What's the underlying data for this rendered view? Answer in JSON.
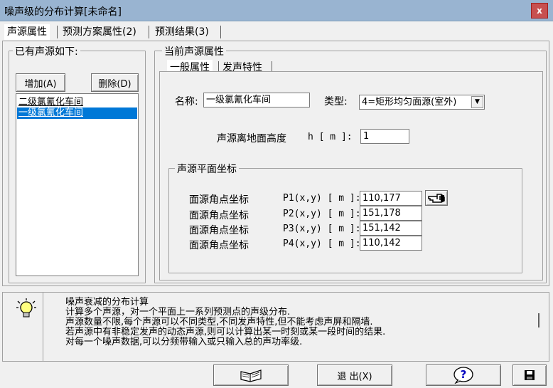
{
  "window": {
    "title": "噪声级的分布计算[未命名]",
    "close_label": "x"
  },
  "tabs": [
    {
      "label": "声源属性"
    },
    {
      "label": "预测方案属性(2)"
    },
    {
      "label": "预测结果(3)"
    }
  ],
  "sources_group": {
    "title": "已有声源如下:",
    "add_label": "增加(A)",
    "delete_label": "删除(D)",
    "items": [
      {
        "label": "二级氯氰化车间"
      },
      {
        "label": "一级氯氰化车间"
      }
    ]
  },
  "current_group": {
    "title": "当前声源属性",
    "subtabs": [
      {
        "label": "一般属性"
      },
      {
        "label": "发声特性"
      }
    ],
    "name_label": "名称:",
    "name_value": "一级氯氰化车间",
    "type_label": "类型:",
    "type_value": "4=矩形均匀面源(室外)",
    "height_label": "声源离地面高度",
    "height_unit": "h [ m ]:",
    "height_value": "1",
    "coords_group_title": "声源平面坐标",
    "coords": [
      {
        "label": "面源角点坐标",
        "key": "P1(x,y) [ m ]:",
        "value": "110,177"
      },
      {
        "label": "面源角点坐标",
        "key": "P2(x,y) [ m ]:",
        "value": "151,178"
      },
      {
        "label": "面源角点坐标",
        "key": "P3(x,y) [ m ]:",
        "value": "151,142"
      },
      {
        "label": "面源角点坐标",
        "key": "P4(x,y) [ m ]:",
        "value": "110,142"
      }
    ]
  },
  "info": {
    "lines": [
      "噪声衰减的分布计算",
      "计算多个声源，对一个平面上一系列预测点的声级分布.",
      "声源数量不限,每个声源可以不同类型,不同发声特性,但不能考虑声屏和隔墙.",
      "若声源中有非稳定发声的动态声源,则可以计算出某一时刻或某一段时间的结果.",
      "对每一个噪声数据,可以分频带输入或只输入总的声功率级."
    ]
  },
  "bottom": {
    "exit_label": "退 出(X)"
  },
  "icons": {
    "close": "close-icon",
    "bulb": "lightbulb-icon",
    "book": "book-icon",
    "help": "help-icon",
    "save": "floppy-disk-icon",
    "hand": "pointing-hand-icon"
  }
}
